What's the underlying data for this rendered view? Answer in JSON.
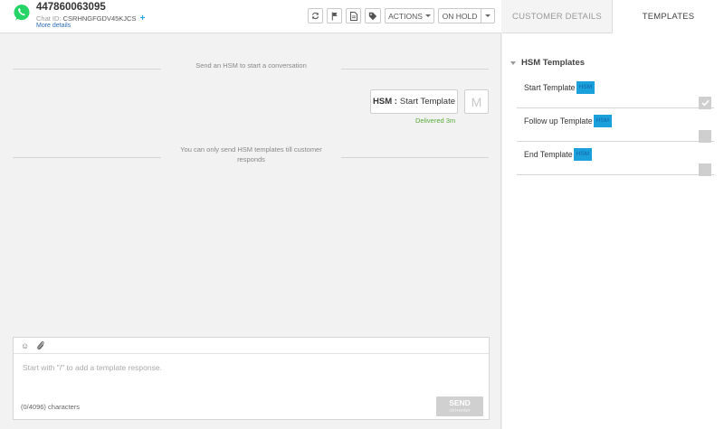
{
  "header": {
    "phone": "447860063095",
    "chat_id_label": "Chat ID:",
    "chat_id_value": "CSRHNGFGDV45KJCS",
    "plus": "+",
    "more_details": "More details",
    "actions_label": "ACTIONS",
    "onhold_label": "ON HOLD"
  },
  "chat": {
    "system_start": "Send an HSM to start a conversation",
    "message_prefix": "HSM :",
    "message_text": "Start Template",
    "avatar_letter": "M",
    "delivered": "Delivered 3m",
    "system_notice": "You can only send HSM templates till customer responds"
  },
  "composer": {
    "emoji": "☺",
    "placeholder": "Start with \"/\" to add a template response.",
    "char_count": "(0/4096) characters",
    "send_label": "SEND",
    "send_hint": "ctrl+enter"
  },
  "tabs": {
    "customer_details": "CUSTOMER DETAILS",
    "templates": "TEMPLATES"
  },
  "templates_panel": {
    "section_title": "HSM Templates",
    "items": [
      {
        "name": "Start Template",
        "tag": "HSM",
        "checked": true
      },
      {
        "name": "Follow up Template",
        "tag": "HSM",
        "checked": false
      },
      {
        "name": "End Template",
        "tag": "HSM",
        "checked": false
      }
    ]
  },
  "colors": {
    "whatsapp_green": "#25d366",
    "hsm_tag_bg": "#1aa0db",
    "delivered_green": "#5aaa3a",
    "link_blue": "#2d6db5"
  }
}
